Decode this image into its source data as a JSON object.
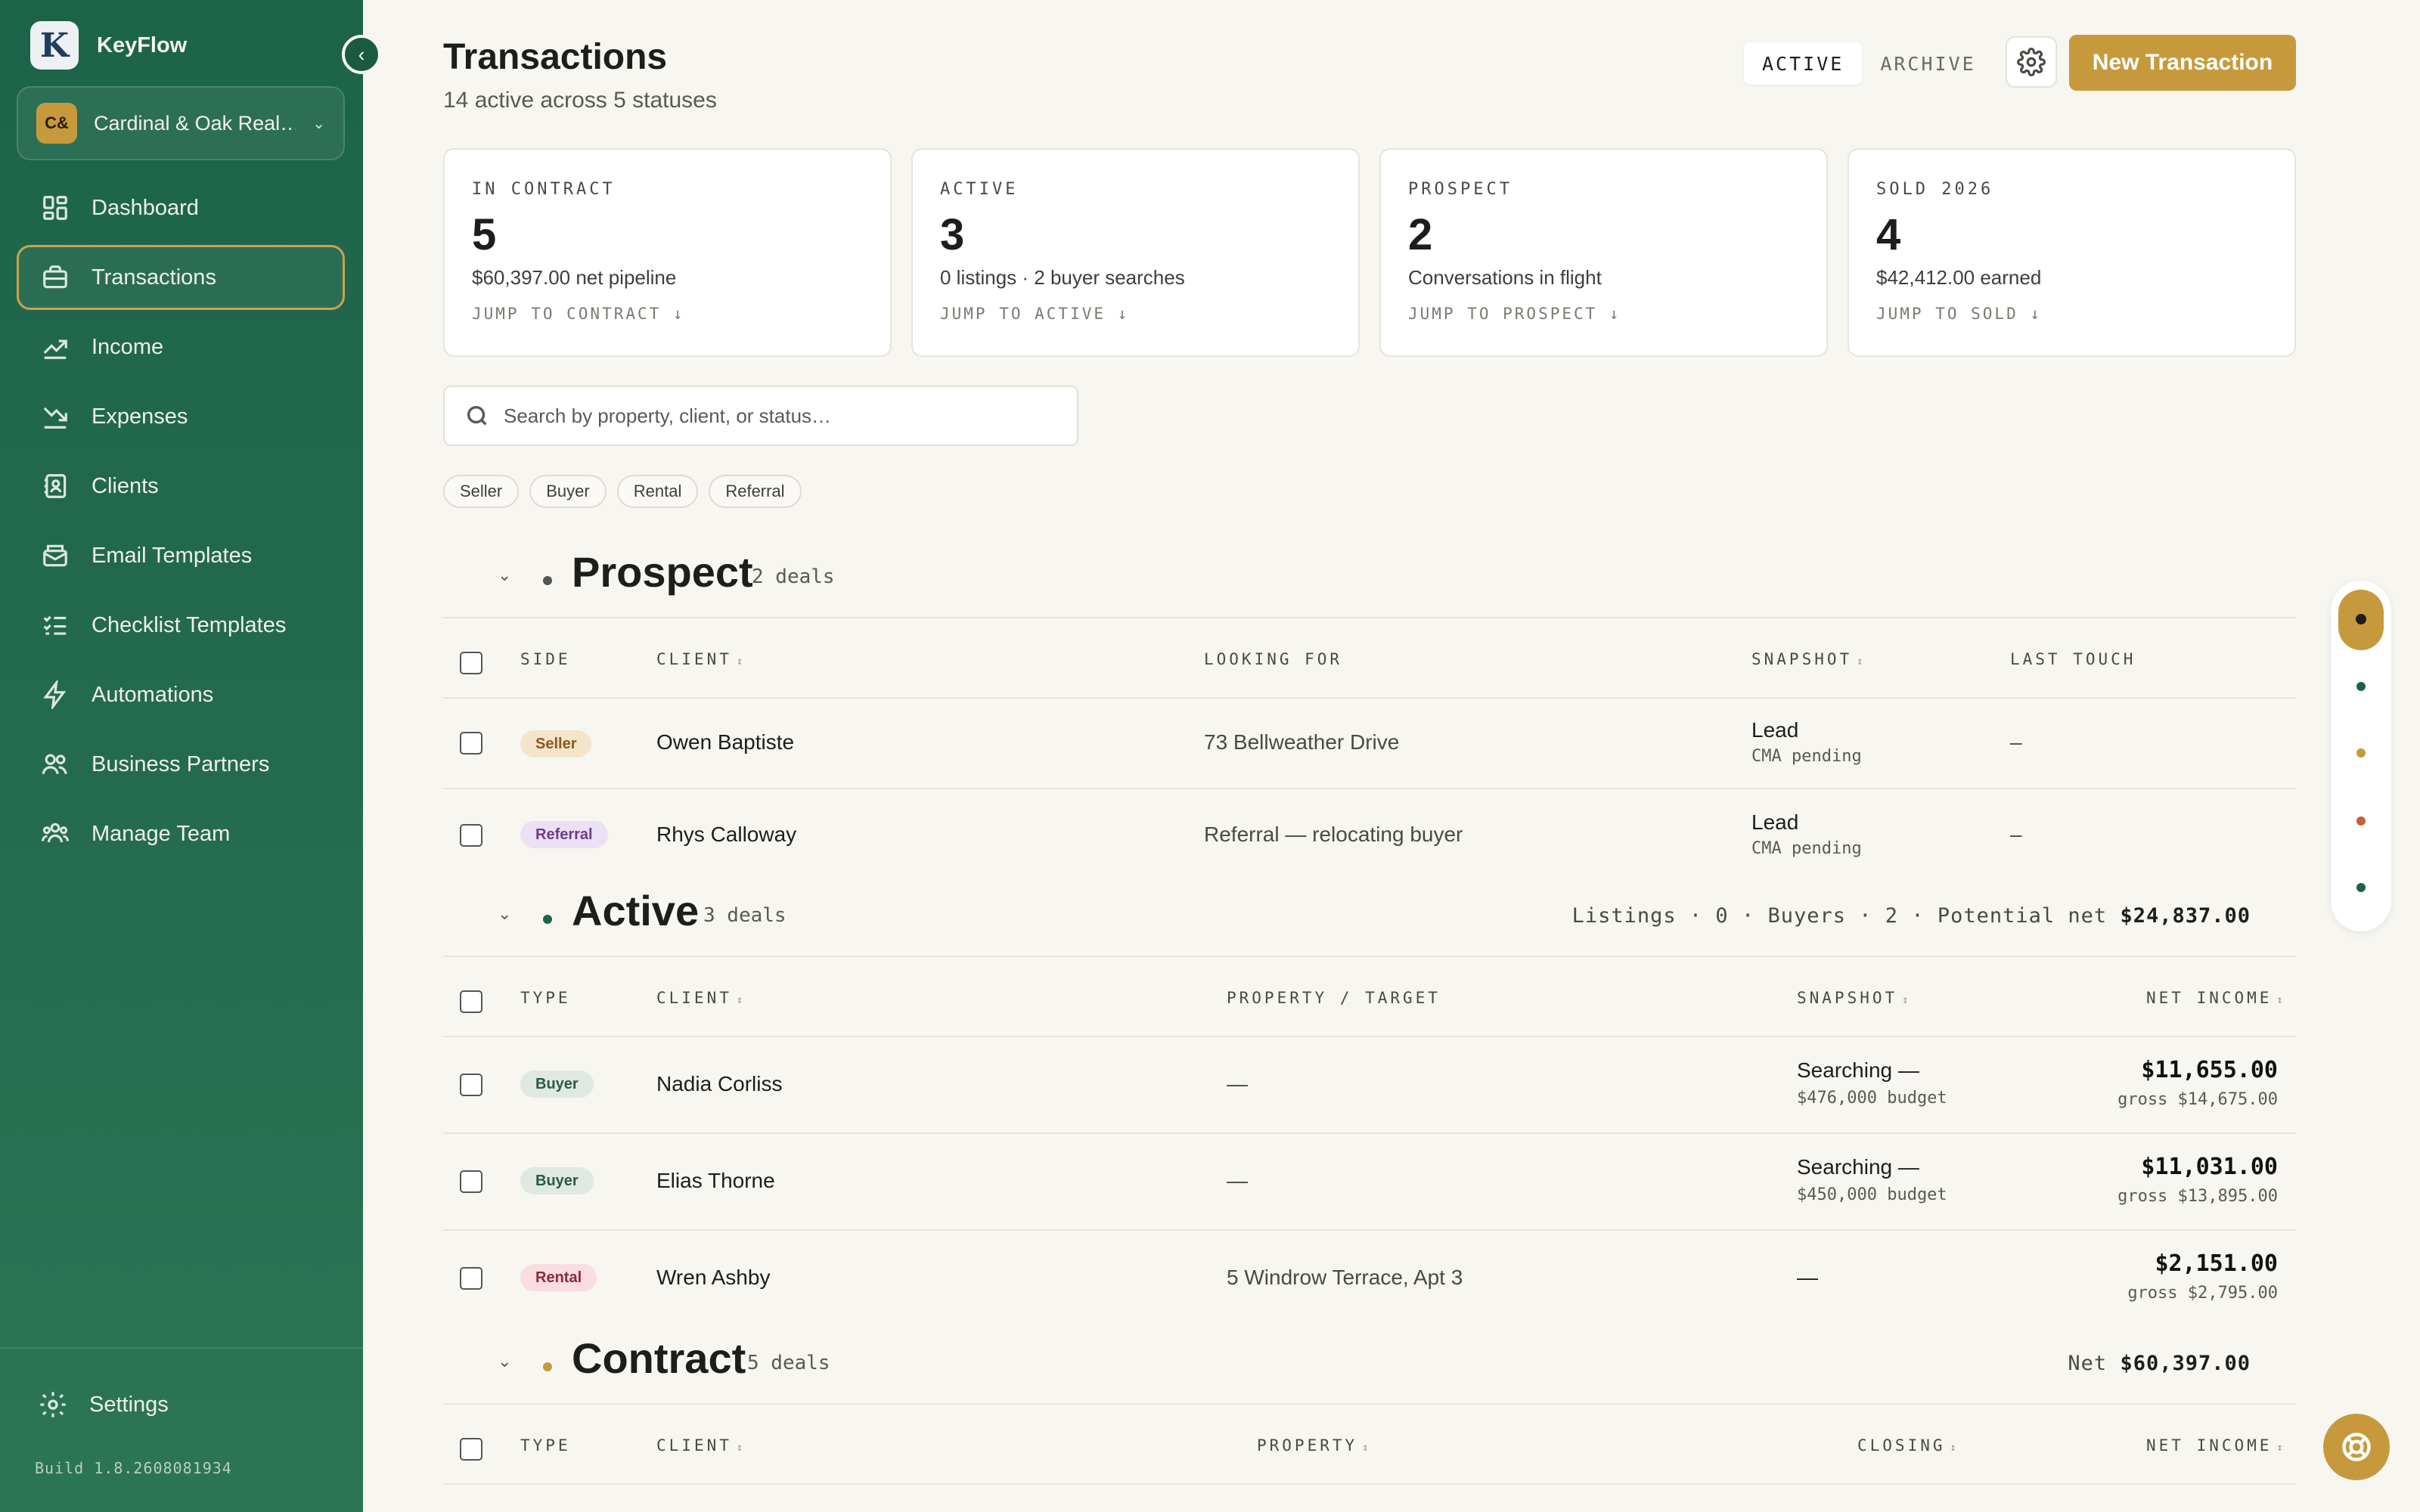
{
  "app": {
    "name": "KeyFlow",
    "logo_letter": "K",
    "build": "Build 1.8.2608081934"
  },
  "workspace": {
    "initials": "C&",
    "name": "Cardinal & Oak Real…"
  },
  "nav": [
    {
      "label": "Dashboard",
      "icon": "dashboard-icon"
    },
    {
      "label": "Transactions",
      "icon": "briefcase-icon",
      "active": true
    },
    {
      "label": "Income",
      "icon": "trending-up-icon"
    },
    {
      "label": "Expenses",
      "icon": "trending-down-icon"
    },
    {
      "label": "Clients",
      "icon": "contacts-icon"
    },
    {
      "label": "Email Templates",
      "icon": "mail-icon"
    },
    {
      "label": "Checklist Templates",
      "icon": "checklist-icon"
    },
    {
      "label": "Automations",
      "icon": "bolt-icon"
    },
    {
      "label": "Business Partners",
      "icon": "users-icon"
    },
    {
      "label": "Manage Team",
      "icon": "team-icon"
    }
  ],
  "settings_label": "Settings",
  "header": {
    "title": "Transactions",
    "subtitle": "14 active across 5 statuses",
    "tab_active": "ACTIVE",
    "tab_archive": "ARCHIVE",
    "new_button": "New Transaction"
  },
  "stats": [
    {
      "label": "IN CONTRACT",
      "value": "5",
      "desc": "$60,397.00 net pipeline",
      "link": "JUMP TO CONTRACT ↓"
    },
    {
      "label": "ACTIVE",
      "value": "3",
      "desc": "0 listings · 2 buyer searches",
      "link": "JUMP TO ACTIVE ↓"
    },
    {
      "label": "PROSPECT",
      "value": "2",
      "desc": "Conversations in flight",
      "link": "JUMP TO PROSPECT ↓"
    },
    {
      "label": "SOLD 2026",
      "value": "4",
      "desc": "$42,412.00 earned",
      "link": "JUMP TO SOLD ↓"
    }
  ],
  "search": {
    "placeholder": "Search by property, client, or status…"
  },
  "filters": [
    "Seller",
    "Buyer",
    "Rental",
    "Referral"
  ],
  "prospect": {
    "title": "Prospect",
    "count": "2 deals",
    "headers": {
      "side": "SIDE",
      "client": "CLIENT",
      "looking": "LOOKING FOR",
      "snapshot": "SNAPSHOT",
      "last": "LAST TOUCH"
    },
    "rows": [
      {
        "badge": "Seller",
        "client": "Owen Baptiste",
        "looking": "73 Bellweather Drive",
        "snap": "Lead",
        "snap_sub": "CMA pending",
        "last": "–"
      },
      {
        "badge": "Referral",
        "client": "Rhys Calloway",
        "looking": "Referral — relocating buyer",
        "snap": "Lead",
        "snap_sub": "CMA pending",
        "last": "–"
      }
    ]
  },
  "active": {
    "title": "Active",
    "count": "3 deals",
    "summary_listings_label": "Listings",
    "summary_listings": "0",
    "summary_buyers_label": "Buyers",
    "summary_buyers": "2",
    "summary_net_label": "Potential net",
    "summary_net": "$24,837.00",
    "headers": {
      "type": "TYPE",
      "client": "CLIENT",
      "property": "PROPERTY / TARGET",
      "snapshot": "SNAPSHOT",
      "net": "NET INCOME"
    },
    "rows": [
      {
        "badge": "Buyer",
        "client": "Nadia Corliss",
        "property": "—",
        "snap": "Searching —",
        "snap_sub": "$476,000 budget",
        "net": "$11,655.00",
        "gross": "gross $14,675.00"
      },
      {
        "badge": "Buyer",
        "client": "Elias Thorne",
        "property": "—",
        "snap": "Searching —",
        "snap_sub": "$450,000 budget",
        "net": "$11,031.00",
        "gross": "gross $13,895.00"
      },
      {
        "badge": "Rental",
        "client": "Wren Ashby",
        "property": "5 Windrow Terrace, Apt 3",
        "snap": "—",
        "snap_sub": "",
        "net": "$2,151.00",
        "gross": "gross $2,795.00"
      }
    ]
  },
  "contract": {
    "title": "Contract",
    "count": "5 deals",
    "summary_net_label": "Net",
    "summary_net": "$60,397.00",
    "headers": {
      "type": "TYPE",
      "client": "CLIENT",
      "property": "PROPERTY",
      "closing": "CLOSING",
      "net": "NET INCOME"
    }
  },
  "colors": {
    "sidebar": "#1c6449",
    "accent": "#c69a3c",
    "prospect_dot": "#555555",
    "active_dot": "#1c6449",
    "contract_dot": "#c69a3c",
    "seller_badge_bg": "#f4e4cc",
    "seller_badge_fg": "#8a5a1c",
    "referral_badge_bg": "#ece0f5",
    "referral_badge_fg": "#6a3d8c",
    "buyer_badge_bg": "#dfe9e2",
    "buyer_badge_fg": "#2c5a43",
    "rental_badge_bg": "#f9dde2",
    "rental_badge_fg": "#8a2a3c"
  }
}
